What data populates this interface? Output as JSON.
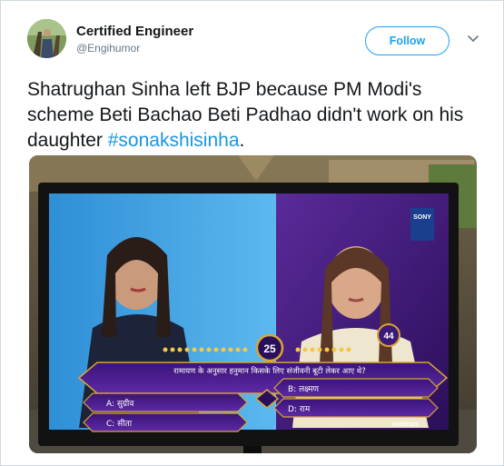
{
  "author": {
    "display_name": "Certified Engineer",
    "handle": "@Engihumor"
  },
  "actions": {
    "follow_label": "Follow"
  },
  "tweet": {
    "text_before": "Shatrughan Sinha left BJP because PM Modi's scheme Beti Bachao Beti Padhao didn't work on his daughter ",
    "hashtag": "#sonakshisinha",
    "text_after": "."
  },
  "media": {
    "tv_logo": "SONY",
    "timer_value": "25",
    "contestant_number": "44",
    "question": "रामायण के अनुसार हनुमान किसके लिए संजीवनी बूटी लेकर आए थे?",
    "options": {
      "A": "A: सुग्रीव",
      "B": "B: लक्ष्मण",
      "C": "C: सीता",
      "D": "D: राम"
    },
    "brand_badge": "hotbeats"
  },
  "colors": {
    "link": "#1b95e0",
    "follow": "#1da1f2",
    "kbc_purple": "#4a1a8c",
    "kbc_gold": "#d9a633"
  }
}
